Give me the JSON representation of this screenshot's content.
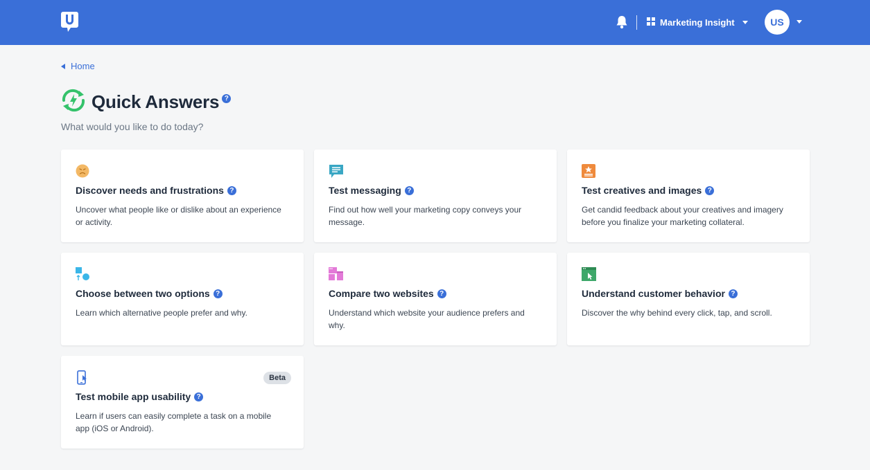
{
  "header": {
    "workspace_label": "Marketing Insight",
    "avatar_initials": "US",
    "brand_color": "#3a6fd8"
  },
  "breadcrumb": {
    "home_label": "Home"
  },
  "page": {
    "title": "Quick Answers",
    "subtitle": "What would you like to do today?",
    "help_glyph": "?"
  },
  "cards": [
    {
      "title": "Discover needs and frustrations",
      "description": "Uncover what people like or dislike about an experience or activity.",
      "icon": "frown-face-icon"
    },
    {
      "title": "Test messaging",
      "description": "Find out how well your marketing copy conveys your message.",
      "icon": "chat-bubble-icon"
    },
    {
      "title": "Test creatives and images",
      "description": "Get candid feedback about your creatives and imagery before you finalize your marketing collateral.",
      "icon": "image-star-icon"
    },
    {
      "title": "Choose between two options",
      "description": "Learn which alternative people prefer and why.",
      "icon": "shapes-choice-icon"
    },
    {
      "title": "Compare two websites",
      "description": "Understand which website your audience prefers and why.",
      "icon": "two-windows-icon"
    },
    {
      "title": "Understand customer behavior",
      "description": "Discover the why behind every click, tap, and scroll.",
      "icon": "browser-cursor-icon"
    },
    {
      "title": "Test mobile app usability",
      "description": "Learn if users can easily complete a task on a mobile app (iOS or Android).",
      "icon": "mobile-phone-icon",
      "badge": "Beta"
    }
  ]
}
